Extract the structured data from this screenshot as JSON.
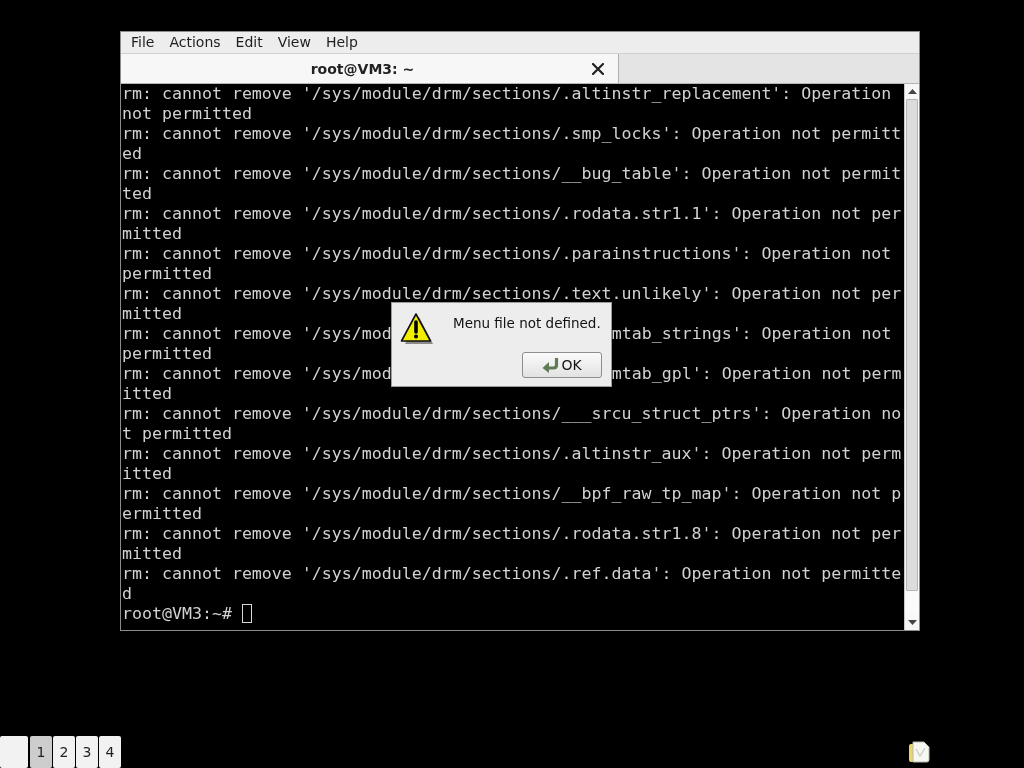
{
  "window": {
    "menu": [
      "File",
      "Actions",
      "Edit",
      "View",
      "Help"
    ],
    "tabs": [
      {
        "title": "root@VM3: ~",
        "selected": true
      }
    ],
    "terminal": {
      "rows": [
        {
          "kind": "line",
          "text": "rm: cannot remove '/sys/module/drm/sections/.altinstr_replacement': Operation"
        },
        {
          "kind": "line",
          "text": "not permitted"
        },
        {
          "kind": "line",
          "text": "rm: cannot remove '/sys/module/drm/sections/.smp_locks': Operation not permitt"
        },
        {
          "kind": "line",
          "text": "ed"
        },
        {
          "kind": "line",
          "text": "rm: cannot remove '/sys/module/drm/sections/__bug_table': Operation not permit"
        },
        {
          "kind": "line",
          "text": "ted"
        },
        {
          "kind": "line",
          "text": "rm: cannot remove '/sys/module/drm/sections/.rodata.str1.1': Operation not per"
        },
        {
          "kind": "line",
          "text": "mitted"
        },
        {
          "kind": "line",
          "text": "rm: cannot remove '/sys/module/drm/sections/.parainstructions': Operation not"
        },
        {
          "kind": "line",
          "text": "permitted"
        },
        {
          "kind": "line",
          "text": "rm: cannot remove '/sys/module/drm/sections/.text.unlikely': Operation not per"
        },
        {
          "kind": "line",
          "text": "mitted"
        },
        {
          "kind": "split",
          "left": "rm: cannot remove '/sys/mod",
          "right": "mtab_strings': Operation not"
        },
        {
          "kind": "line",
          "text": "permitted"
        },
        {
          "kind": "split",
          "left": "rm: cannot remove '/sys/mod",
          "right": "mtab_gpl': Operation not perm"
        },
        {
          "kind": "line",
          "text": "itted"
        },
        {
          "kind": "line",
          "text": "rm: cannot remove '/sys/module/drm/sections/___srcu_struct_ptrs': Operation no"
        },
        {
          "kind": "line",
          "text": "t permitted"
        },
        {
          "kind": "line",
          "text": "rm: cannot remove '/sys/module/drm/sections/.altinstr_aux': Operation not perm"
        },
        {
          "kind": "line",
          "text": "itted"
        },
        {
          "kind": "line",
          "text": "rm: cannot remove '/sys/module/drm/sections/__bpf_raw_tp_map': Operation not p"
        },
        {
          "kind": "line",
          "text": "ermitted"
        },
        {
          "kind": "line",
          "text": "rm: cannot remove '/sys/module/drm/sections/.rodata.str1.8': Operation not per"
        },
        {
          "kind": "line",
          "text": "mitted"
        },
        {
          "kind": "line",
          "text": "rm: cannot remove '/sys/module/drm/sections/.ref.data': Operation not permitte"
        },
        {
          "kind": "line",
          "text": "d"
        }
      ],
      "prompt": "root@VM3:~#",
      "cursor_focused": false
    }
  },
  "dialog": {
    "message": "Menu file not defined.",
    "button": "OK"
  },
  "taskbar": {
    "desktops": [
      {
        "label": "1",
        "selected": true
      },
      {
        "label": "2",
        "selected": false
      },
      {
        "label": "3",
        "selected": false
      },
      {
        "label": "4",
        "selected": false
      }
    ]
  }
}
